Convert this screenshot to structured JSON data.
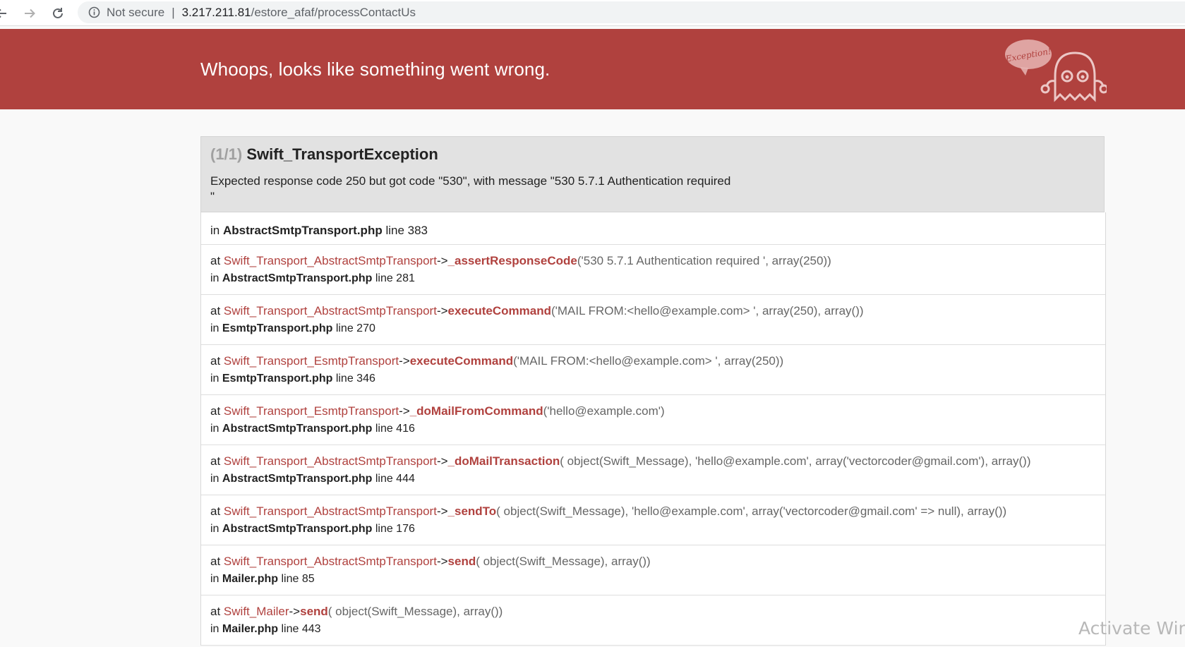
{
  "browser": {
    "security_label": "Not secure",
    "separator": "|",
    "url_host": "3.217.211.81",
    "url_path": "/estore_afaf/processContactUs"
  },
  "header": {
    "title": "Whoops, looks like something went wrong.",
    "ghost_text": "Exception!",
    "bg_color": "#b0413e"
  },
  "exception": {
    "count": "(1/1)",
    "class": "Swift_TransportException",
    "message": "Expected response code 250 but got code \"530\", with message \"530 5.7.1 Authentication required\n\""
  },
  "trace": {
    "first": {
      "prefix": "in",
      "file": "AbstractSmtpTransport.php",
      "line": "line 383"
    },
    "frames": [
      {
        "at": "at",
        "cls": "Swift_Transport_AbstractSmtpTransport",
        "arrow": "->",
        "method": "_assertResponseCode",
        "args": "('530 5.7.1 Authentication required ', array(250))",
        "in": "in",
        "file": "AbstractSmtpTransport.php",
        "line": "line 281"
      },
      {
        "at": "at",
        "cls": "Swift_Transport_AbstractSmtpTransport",
        "arrow": "->",
        "method": "executeCommand",
        "args": "('MAIL FROM:<hello@example.com> ', array(250), array())",
        "in": "in",
        "file": "EsmtpTransport.php",
        "line": "line 270"
      },
      {
        "at": "at",
        "cls": "Swift_Transport_EsmtpTransport",
        "arrow": "->",
        "method": "executeCommand",
        "args": "('MAIL FROM:<hello@example.com> ', array(250))",
        "in": "in",
        "file": "EsmtpTransport.php",
        "line": "line 346"
      },
      {
        "at": "at",
        "cls": "Swift_Transport_EsmtpTransport",
        "arrow": "->",
        "method": "_doMailFromCommand",
        "args": "('hello@example.com')",
        "in": "in",
        "file": "AbstractSmtpTransport.php",
        "line": "line 416"
      },
      {
        "at": "at",
        "cls": "Swift_Transport_AbstractSmtpTransport",
        "arrow": "->",
        "method": "_doMailTransaction",
        "args": "( object(Swift_Message), 'hello@example.com', array('vectorcoder@gmail.com'), array())",
        "in": "in",
        "file": "AbstractSmtpTransport.php",
        "line": "line 444"
      },
      {
        "at": "at",
        "cls": "Swift_Transport_AbstractSmtpTransport",
        "arrow": "->",
        "method": "_sendTo",
        "args": "( object(Swift_Message), 'hello@example.com', array('vectorcoder@gmail.com' => null), array())",
        "in": "in",
        "file": "AbstractSmtpTransport.php",
        "line": "line 176"
      },
      {
        "at": "at",
        "cls": "Swift_Transport_AbstractSmtpTransport",
        "arrow": "->",
        "method": "send",
        "args": "( object(Swift_Message), array())",
        "in": "in",
        "file": "Mailer.php",
        "line": "line 85"
      },
      {
        "at": "at",
        "cls": "Swift_Mailer",
        "arrow": "->",
        "method": "send",
        "args": "( object(Swift_Message), array())",
        "in": "in",
        "file": "Mailer.php",
        "line": "line 443"
      }
    ]
  },
  "watermark": "Activate Wind"
}
